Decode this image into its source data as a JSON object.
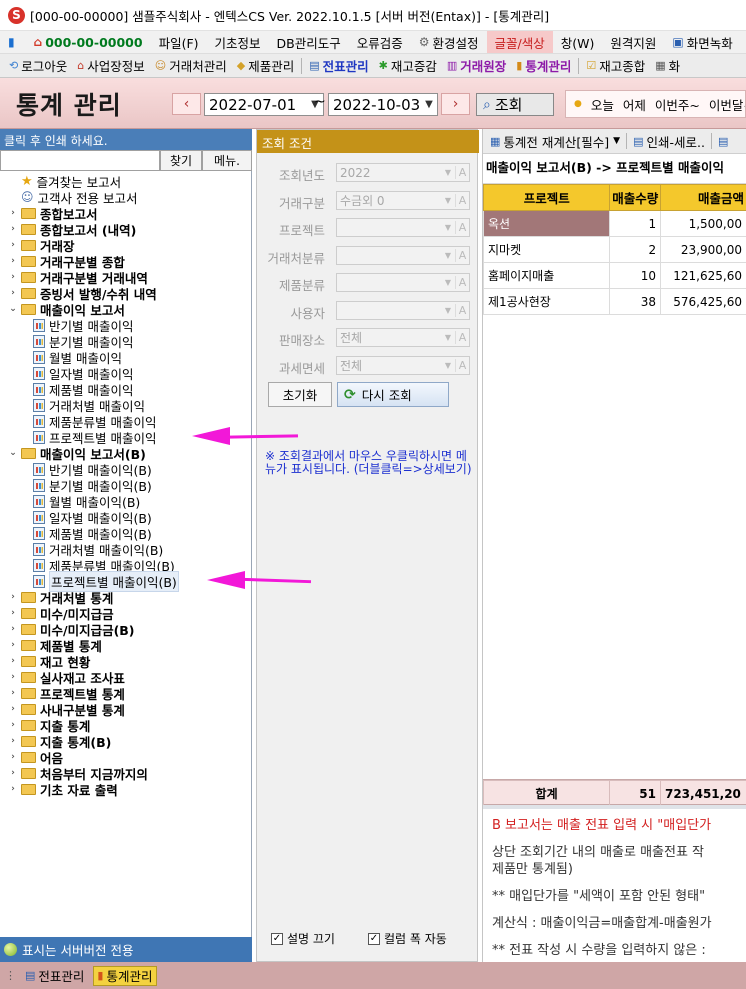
{
  "window": {
    "title": "[000-00-00000] 샘플주식회사 - 엔텍스CS Ver. 2022.10.1.5 [서버 버전(Entax)] - [통계관리]"
  },
  "menu": {
    "company_code": "000-00-00000",
    "items": [
      "파일(F)",
      "기초정보",
      "DB관리도구",
      "오류검증",
      "환경설정",
      "글꼴/색상",
      "창(W)",
      "원격지원",
      "화면녹화"
    ]
  },
  "toolbar": {
    "items": [
      "로그아웃",
      "사업장정보",
      "거래처관리",
      "제품관리",
      "전표관리",
      "재고증감",
      "거래원장",
      "통계관리",
      "재고종합",
      "화"
    ]
  },
  "header": {
    "title": "통계 관리",
    "date_from": "2022-07-01",
    "tilde": "~",
    "date_to": "2022-10-03",
    "search_label": "조회",
    "quick_ranges": [
      "오늘",
      "어제",
      "이번주~",
      "이번달~"
    ]
  },
  "left_panel": {
    "header": "클릭 후 인쇄 하세요.",
    "find_label": "찾기",
    "menu_label": "메뉴.",
    "tree": [
      {
        "label": "즐겨찾는 보고서",
        "type": "star"
      },
      {
        "label": "고객사 전용 보고서",
        "type": "person"
      },
      {
        "label": "종합보고서",
        "type": "folder"
      },
      {
        "label": "종합보고서 (내역)",
        "type": "folder"
      },
      {
        "label": "거래장",
        "type": "folder"
      },
      {
        "label": "거래구분별 종합",
        "type": "folder"
      },
      {
        "label": "거래구분별 거래내역",
        "type": "folder"
      },
      {
        "label": "증빙서 발행/수취 내역",
        "type": "folder"
      },
      {
        "label": "매출이익 보고서",
        "type": "folder-open"
      },
      {
        "label": "반기별 매출이익",
        "type": "report"
      },
      {
        "label": "분기별 매출이익",
        "type": "report"
      },
      {
        "label": "월별 매출이익",
        "type": "report"
      },
      {
        "label": "일자별 매출이익",
        "type": "report"
      },
      {
        "label": "제품별 매출이익",
        "type": "report"
      },
      {
        "label": "거래처별 매출이익",
        "type": "report"
      },
      {
        "label": "제품분류별 매출이익",
        "type": "report"
      },
      {
        "label": "프로젝트별 매출이익",
        "type": "report"
      },
      {
        "label": "매출이익 보고서(B)",
        "type": "folder-open"
      },
      {
        "label": "반기별 매출이익(B)",
        "type": "report"
      },
      {
        "label": "분기별 매출이익(B)",
        "type": "report"
      },
      {
        "label": "월별 매출이익(B)",
        "type": "report"
      },
      {
        "label": "일자별 매출이익(B)",
        "type": "report"
      },
      {
        "label": "제품별 매출이익(B)",
        "type": "report"
      },
      {
        "label": "거래처별 매출이익(B)",
        "type": "report"
      },
      {
        "label": "제품분류별 매출이익(B)",
        "type": "report"
      },
      {
        "label": "프로젝트별 매출이익(B)",
        "type": "report-selected"
      },
      {
        "label": "거래처별 통계",
        "type": "folder"
      },
      {
        "label": "미수/미지급금",
        "type": "folder"
      },
      {
        "label": "미수/미지급금(B)",
        "type": "folder"
      },
      {
        "label": "제품별 통계",
        "type": "folder"
      },
      {
        "label": "재고 현황",
        "type": "folder"
      },
      {
        "label": "실사재고 조사표",
        "type": "folder"
      },
      {
        "label": "프로젝트별 통계",
        "type": "folder"
      },
      {
        "label": "사내구분별 통계",
        "type": "folder"
      },
      {
        "label": "지출 통계",
        "type": "folder"
      },
      {
        "label": "지출 통계(B)",
        "type": "folder"
      },
      {
        "label": "어음",
        "type": "folder"
      },
      {
        "label": "처음부터 지금까지의",
        "type": "folder"
      },
      {
        "label": "기초 자료 출력",
        "type": "folder"
      }
    ],
    "footer": "표시는 서버버전 전용"
  },
  "mid_panel": {
    "header": "조회 조건",
    "fields": [
      {
        "label": "조회년도",
        "value": "2022"
      },
      {
        "label": "거래구분",
        "value": "수금외 0"
      },
      {
        "label": "프로젝트",
        "value": ""
      },
      {
        "label": "거래처분류",
        "value": ""
      },
      {
        "label": "제품분류",
        "value": ""
      },
      {
        "label": "사용자",
        "value": ""
      },
      {
        "label": "판매장소",
        "value": "전체"
      },
      {
        "label": "과세면세",
        "value": "전체"
      }
    ],
    "reset_label": "초기화",
    "reload_label": "다시 조회",
    "hint": "※ 조회결과에서 마우스 우클릭하시면 메뉴가 표시됩니다. (더블클릭=>상세보기)",
    "opt_desc_off": "설명 끄기",
    "opt_col_auto": "컬럼 폭 자동"
  },
  "right_panel": {
    "toolbar_recalc": "통계전 재계산[필수]",
    "toolbar_print": "인쇄-세로..",
    "report_title": "매출이익 보고서(B) -> 프로젝트별 매출이익",
    "columns": [
      "프로젝트",
      "매출수량",
      "매출금액"
    ],
    "rows": [
      {
        "project": "옥션",
        "qty": "1",
        "amount": "1,500,00"
      },
      {
        "project": "지마켓",
        "qty": "2",
        "amount": "23,900,00"
      },
      {
        "project": "홈페이지매출",
        "qty": "10",
        "amount": "121,625,60"
      },
      {
        "project": "제1공사현장",
        "qty": "38",
        "amount": "576,425,60"
      }
    ],
    "total_label": "합계",
    "total_qty": "51",
    "total_amount": "723,451,20",
    "desc_lines": [
      "B 보고서는 매출 전표 입력 시 \"매입단가",
      "상단 조회기간 내의 매출로 매출전표 작",
      "제품만 통계됨)",
      "** 매입단가를 \"세액이 포함 안된 형태\"",
      "계산식 : 매출이익금=매출합계-매출원가",
      "** 전표 작성 시 수량을 입력하지 않은 :"
    ]
  },
  "taskbar": {
    "items": [
      "전표관리",
      "통계관리"
    ]
  },
  "colors": {
    "accent": "#4a7eb8",
    "header_bg": "#f9dede",
    "grid_header": "#f4c82c",
    "annotation_arrow": "#f218d8"
  }
}
